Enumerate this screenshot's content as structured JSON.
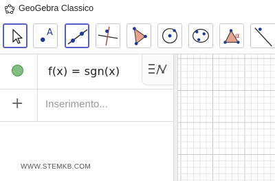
{
  "window": {
    "title": "GeoGebra Classico"
  },
  "toolbar": {
    "tools": [
      {
        "name": "move",
        "selected": true
      },
      {
        "name": "point"
      },
      {
        "name": "line",
        "selected": true
      },
      {
        "name": "perpendicular-line"
      },
      {
        "name": "polygon"
      },
      {
        "name": "circle-center-point"
      },
      {
        "name": "circle-three-points"
      },
      {
        "name": "angle"
      },
      {
        "name": "reflect-about-line"
      }
    ],
    "point_label": "A",
    "angle_label": "α"
  },
  "algebra": {
    "rows": [
      {
        "expression": "f(x) = sgn(x)",
        "visible": true,
        "color": "#7fbf7f"
      }
    ],
    "input_placeholder": "Inserimento...",
    "add_symbol": "+"
  },
  "watermark": "WWW.STEMKB.COM",
  "colors": {
    "accent": "#5a5fc4",
    "point_blue": "#1e3a9a",
    "line_red": "#d0302a",
    "polygon_fill": "#e8a28c"
  }
}
